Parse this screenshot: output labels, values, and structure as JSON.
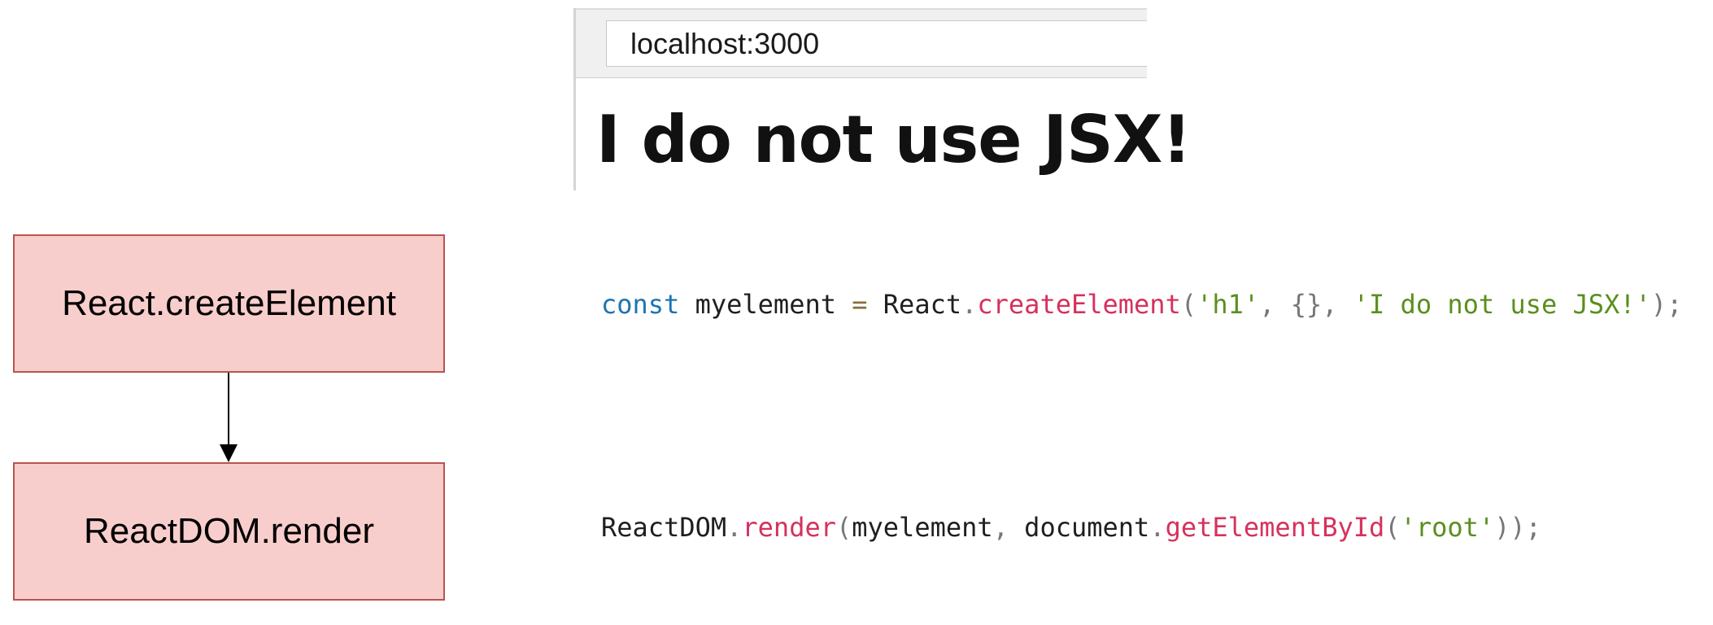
{
  "browser": {
    "address": "localhost:3000",
    "heading": "I do not use JSX!"
  },
  "diagram": {
    "box_create": "React.createElement",
    "box_render": "ReactDOM.render"
  },
  "code": {
    "line1": {
      "kw_const": "const",
      "var_name": " myelement ",
      "eq": "=",
      "obj_react": " React",
      "dot1": ".",
      "fn_create": "createElement",
      "paren_open": "(",
      "arg_tag": "'h1'",
      "comma1": ", {}, ",
      "arg_text": "'I do not use JSX!'",
      "paren_close": ");"
    },
    "line2": {
      "obj_reactdom": "ReactDOM",
      "dot1": ".",
      "fn_render": "render",
      "paren_open": "(",
      "arg_el": "myelement",
      "comma": ", ",
      "obj_document": "document",
      "dot2": ".",
      "fn_get": "getElementById",
      "paren_open2": "(",
      "arg_root": "'root'",
      "paren_close": "));"
    }
  },
  "colors": {
    "box_fill": "#f8cecc",
    "box_border": "#b85450",
    "keyword": "#1f74b3",
    "function": "#d6315d",
    "string": "#5a8f1e"
  }
}
